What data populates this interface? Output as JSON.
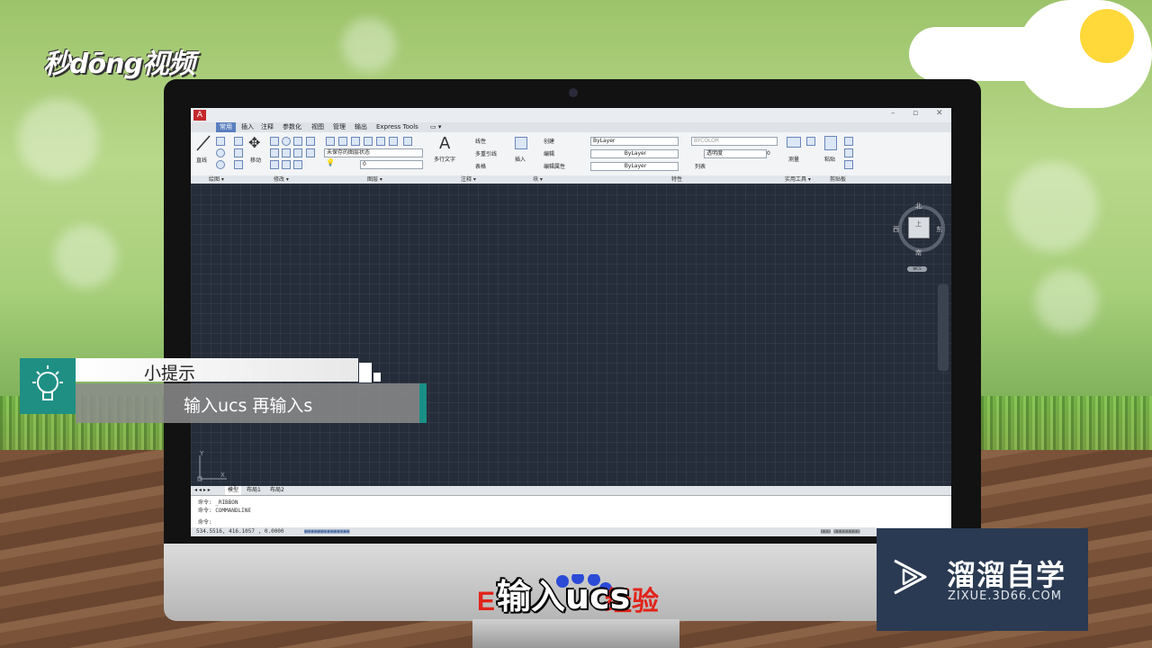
{
  "watermark_tl": "秒dōng视频",
  "app": {
    "title_icon": "A",
    "tabs": [
      "常用",
      "插入",
      "注释",
      "参数化",
      "视图",
      "管理",
      "输出",
      "Express Tools"
    ],
    "tab_extra": "▭ ▾",
    "ribbon": {
      "draw": {
        "line_label": "直线"
      },
      "modify": {
        "move_label": "移动"
      },
      "layers": {
        "state": "未保存的图层状态",
        "current": "0"
      },
      "annotation": {
        "mtext_label": "多行文字",
        "linear": "线性",
        "multileader": "多重引线",
        "table": "表格"
      },
      "block": {
        "insert_label": "插入",
        "create": "创建",
        "edit": "编辑",
        "edit_attr": "编辑属性"
      },
      "properties": {
        "color": "ByLayer",
        "linetype": "ByLayer",
        "lineweight": "ByLayer",
        "plotstyle": "BYCOLOR",
        "transparency_label": "透明度",
        "transparency": "0",
        "list": "列表"
      },
      "utilities": {
        "measure_label": "测量"
      },
      "clipboard": {
        "paste_label": "粘贴"
      }
    },
    "panels": [
      "绘图 ▾",
      "修改 ▾",
      "图层 ▾",
      "注释 ▾",
      "块 ▾",
      "特性",
      "实用工具 ▾",
      "剪贴板"
    ],
    "viewcube": {
      "north": "北",
      "south": "南",
      "east": "东",
      "west": "西",
      "center": "上",
      "wcs": "WCS"
    },
    "ucs": {
      "y": "Y",
      "x": "X"
    },
    "layout_tabs": [
      "模型",
      "布局1",
      "布局2"
    ],
    "nav_arrows": "◂ ◂ ▸ ▸",
    "command_history": [
      "命令: _RIBBON",
      "命令: COMMANDLINE"
    ],
    "command_prompt": "命令:",
    "coords": "534.5516,  416.1057 , 0.0000"
  },
  "tip": {
    "title": "小提示",
    "body": "输入ucs 再输入s"
  },
  "subtitle": "输入ucs",
  "baidu_logo_text": "Bai du 经验",
  "zixue": {
    "title": "溜溜自学",
    "url": "ZIXUE.3D66.COM"
  }
}
